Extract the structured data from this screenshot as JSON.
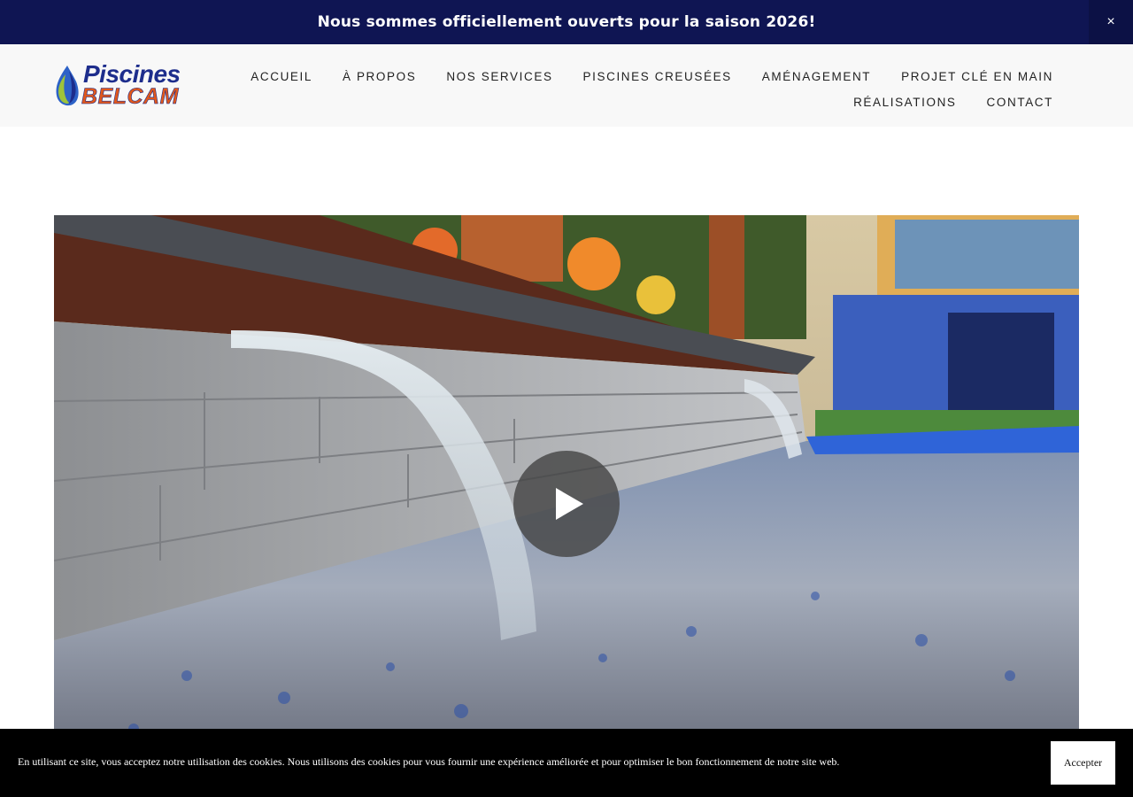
{
  "announcement": {
    "text": "Nous sommes officiellement ouverts pour la saison 2026!",
    "close_label": "×"
  },
  "brand": {
    "line1": "Piscines",
    "line2": "BELCAM",
    "colors": {
      "primary": "#1d2d8c",
      "secondary": "#e1581c",
      "announcement_bg": "#0f1553"
    }
  },
  "nav": {
    "row1": [
      {
        "label": "ACCUEIL"
      },
      {
        "label": "À PROPOS"
      },
      {
        "label": "NOS SERVICES"
      },
      {
        "label": "PISCINES CREUSÉES"
      },
      {
        "label": "AMÉNAGEMENT"
      },
      {
        "label": "PROJET CLÉ EN MAIN"
      }
    ],
    "row2": [
      {
        "label": "RÉALISATIONS"
      },
      {
        "label": "CONTACT"
      }
    ]
  },
  "video": {
    "icon": "play-icon"
  },
  "cookie": {
    "text": "En utilisant ce site, vous acceptez notre utilisation des cookies. Nous utilisons des cookies pour vous fournir une expérience améliorée et pour optimiser le bon fonctionnement de notre site web.",
    "accept_label": "Accepter"
  }
}
